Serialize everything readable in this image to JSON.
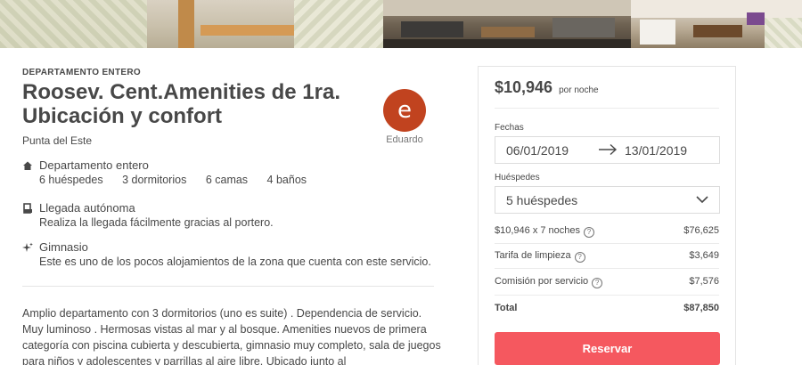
{
  "listing": {
    "type_label": "DEPARTAMENTO ENTERO",
    "title": "Roosev. Cent.Amenities de 1ra. Ubicación y confort",
    "city": "Punta del Este",
    "host": {
      "initial": "e",
      "name": "Eduardo",
      "avatar_color": "#c1431f"
    }
  },
  "features": [
    {
      "icon": "home-icon",
      "heading": "Departamento entero",
      "specs": [
        "6 huéspedes",
        "3 dormitorios",
        "6 camas",
        "4 baños"
      ]
    },
    {
      "icon": "key-icon",
      "heading": "Llegada autónoma",
      "detail": "Realiza la llegada fácilmente gracias al portero."
    },
    {
      "icon": "sparkle-icon",
      "heading": "Gimnasio",
      "detail": "Este es uno de los pocos alojamientos de la zona que cuenta con este servicio."
    }
  ],
  "description": "Amplio departamento con 3 dormitorios (uno es suite) . Dependencia de servicio. Muy luminoso . Hermosas vistas al mar y al bosque. Amenities nuevos de primera categoría con piscina cubierta y descubierta, gimnasio muy completo, sala de juegos para niños y adolescentes y parrillas al aire libre. Ubicado junto al",
  "booking": {
    "price": "$10,946",
    "per_night": "por noche",
    "dates_label": "Fechas",
    "checkin": "06/01/2019",
    "checkout": "13/01/2019",
    "guests_label": "Huéspedes",
    "guests_value": "5 huéspedes",
    "lines": [
      {
        "label": "$10,946 x 7 noches",
        "value": "$76,625",
        "help": true
      },
      {
        "label": "Tarifa de limpieza",
        "value": "$3,649",
        "help": true
      },
      {
        "label": "Comisión por servicio",
        "value": "$7,576",
        "help": true
      }
    ],
    "total_label": "Total",
    "total_value": "$87,850",
    "reserve_label": "Reservar",
    "reserve_color": "#f5585f"
  }
}
